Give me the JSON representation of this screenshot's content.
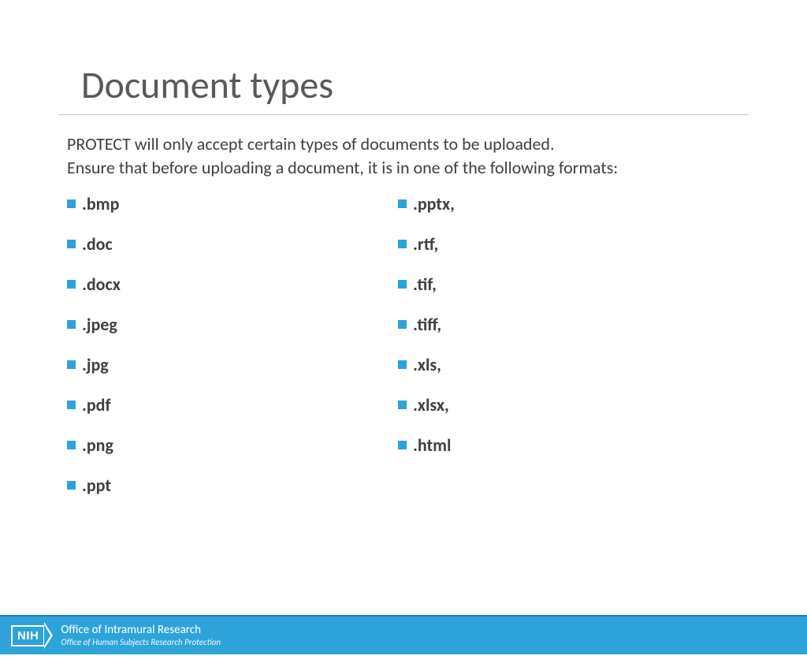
{
  "title": "Document types",
  "intro_line1": "PROTECT will only accept certain types of documents to be uploaded.",
  "intro_line2": "Ensure that before uploading a document, it is in one of the following formats:",
  "left_items": [
    ".bmp",
    ".doc",
    ".docx",
    ".jpeg",
    ".jpg",
    ".pdf",
    ".png",
    ".ppt"
  ],
  "right_items": [
    ".pptx,",
    ".rtf,",
    ".tif,",
    ".tiff,",
    ".xls,",
    ".xlsx,",
    ".html"
  ],
  "footer": {
    "logo_text": "NIH",
    "line1": "Office of Intramural Research",
    "line2": "Office of Human Subjects Research Protection"
  }
}
